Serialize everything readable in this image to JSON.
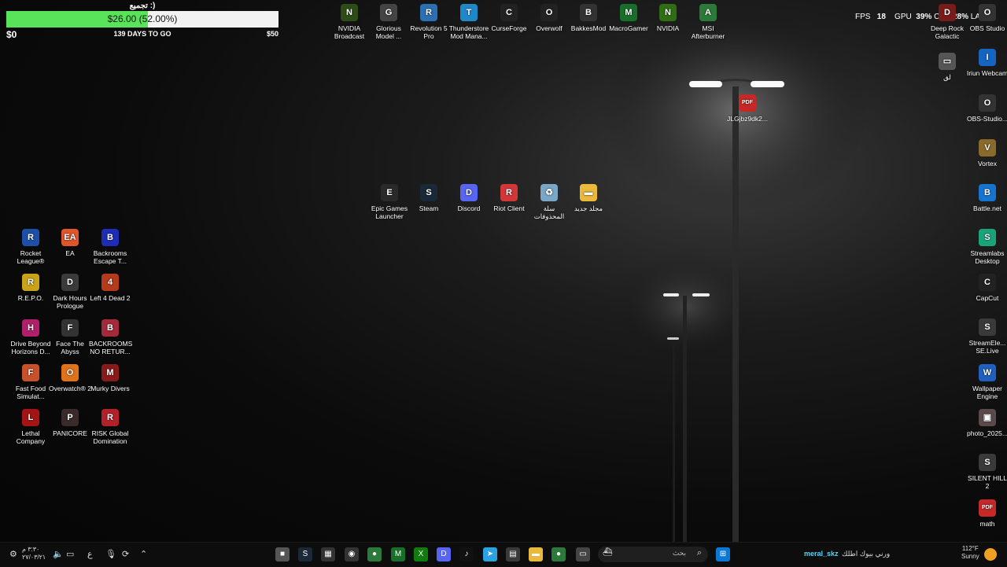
{
  "donation": {
    "title": "تجميع :)",
    "amount_label": "$26.00 (52.00%)",
    "progress_fraction": 0.52,
    "min": "$0",
    "days": "139 DAYS TO GO",
    "max": "$50"
  },
  "overlay": {
    "fps_label": "FPS",
    "fps": "18",
    "gpu_label": "GPU",
    "gpu": "39%",
    "cpu_label": "CPU",
    "cpu": "28%",
    "lat_label": "LAT"
  },
  "top_icons": [
    {
      "label": "NVIDIA Broadcast",
      "icon": "nvidia-broadcast-icon",
      "color": "#2c4d16",
      "glyph": "N"
    },
    {
      "label": "Glorious Model ...",
      "icon": "glorious-icon",
      "color": "#444",
      "glyph": "G"
    },
    {
      "label": "Revolution 5 Pro",
      "icon": "revolution-icon",
      "color": "#2d6fb3",
      "glyph": "R"
    },
    {
      "label": "Thunderstore Mod Mana...",
      "icon": "thunderstore-icon",
      "color": "#1e88c8",
      "glyph": "T"
    },
    {
      "label": "CurseForge",
      "icon": "curseforge-icon",
      "color": "#222",
      "glyph": "C"
    },
    {
      "label": "Overwolf",
      "icon": "overwolf-icon",
      "color": "#222",
      "glyph": "O"
    },
    {
      "label": "BakkesMod",
      "icon": "bakkesmod-icon",
      "color": "#333",
      "glyph": "B"
    },
    {
      "label": "MacroGamer",
      "icon": "macrogamer-icon",
      "color": "#1a6e2b",
      "glyph": "M"
    },
    {
      "label": "NVIDIA",
      "icon": "nvidia-icon",
      "color": "#2f6e12",
      "glyph": "N"
    },
    {
      "label": "MSI Afterburner",
      "icon": "msi-afterburner-icon",
      "color": "#2c7a3a",
      "glyph": "A"
    }
  ],
  "right_icons": [
    {
      "label": "Deep Rock Galactic",
      "icon": "deep-rock-icon",
      "color": "#7a1b1b",
      "glyph": "D"
    },
    {
      "label": "OBS Studio",
      "icon": "obs-studio-icon",
      "color": "#333",
      "glyph": "O"
    },
    {
      "label": "لق",
      "icon": "screenshot-icon",
      "color": "#555",
      "glyph": "▭"
    },
    {
      "label": "Iriun Webcam",
      "icon": "iriun-webcam-icon",
      "color": "#1565c0",
      "glyph": "I"
    },
    {
      "label": "OBS-Studio...",
      "icon": "obs-installer-icon",
      "color": "#333",
      "glyph": "O"
    },
    {
      "label": "Vortex",
      "icon": "vortex-icon",
      "color": "#8a6a2a",
      "glyph": "V"
    },
    {
      "label": "Battle.net",
      "icon": "battlenet-icon",
      "color": "#1673d0",
      "glyph": "B"
    },
    {
      "label": "Streamlabs Desktop",
      "icon": "streamlabs-icon",
      "color": "#1aa37a",
      "glyph": "S"
    },
    {
      "label": "CapCut",
      "icon": "capcut-icon",
      "color": "#222",
      "glyph": "C"
    },
    {
      "label": "StreamEle... SE.Live",
      "icon": "streamelements-icon",
      "color": "#3a3a3a",
      "glyph": "S"
    },
    {
      "label": "Wallpaper Engine",
      "icon": "wallpaper-engine-icon",
      "color": "#1f5fbf",
      "glyph": "W"
    },
    {
      "label": "photo_2025...",
      "icon": "photo-icon",
      "color": "#5a4a4a",
      "glyph": "▣"
    },
    {
      "label": "SILENT HILL 2",
      "icon": "silent-hill-icon",
      "color": "#3a3a3a",
      "glyph": "S"
    },
    {
      "label": "math",
      "icon": "pdf-icon",
      "color": "#c62828",
      "glyph": "PDF"
    }
  ],
  "pdf_file": {
    "label": "JLGjbz9dk2...",
    "icon": "pdf-icon",
    "color": "#c62828",
    "glyph": "PDF"
  },
  "middle_icons": [
    {
      "label": "Epic Games Launcher",
      "icon": "epic-games-icon",
      "color": "#2a2a2a",
      "glyph": "E"
    },
    {
      "label": "Steam",
      "icon": "steam-icon",
      "color": "#1b2838",
      "glyph": "S"
    },
    {
      "label": "Discord",
      "icon": "discord-icon",
      "color": "#5865f2",
      "glyph": "D"
    },
    {
      "label": "Riot Client",
      "icon": "riot-client-icon",
      "color": "#d13639",
      "glyph": "R"
    },
    {
      "label": "سلة المحذوفات",
      "icon": "recycle-bin-icon",
      "color": "#7aa7c7",
      "glyph": "♻"
    },
    {
      "label": "مجلد جديد",
      "icon": "folder-icon",
      "color": "#e8b93b",
      "glyph": "▬"
    }
  ],
  "left_icons": [
    {
      "label": "Rocket League®",
      "icon": "rocket-league-icon",
      "color": "#1d4fa8",
      "glyph": "R"
    },
    {
      "label": "EA",
      "icon": "ea-icon",
      "color": "#e0552a",
      "glyph": "EA"
    },
    {
      "label": "Backrooms Escape T...",
      "icon": "backrooms-escape-icon",
      "color": "#1d2db8",
      "glyph": "B"
    },
    {
      "label": "R.E.P.O.",
      "icon": "repo-icon",
      "color": "#c9a21a",
      "glyph": "R"
    },
    {
      "label": "Dark Hours Prologue",
      "icon": "dark-hours-icon",
      "color": "#3a3a3a",
      "glyph": "D"
    },
    {
      "label": "Left 4 Dead 2",
      "icon": "left4dead-icon",
      "color": "#b33a1a",
      "glyph": "4"
    },
    {
      "label": "Drive Beyond Horizons D...",
      "icon": "drive-beyond-icon",
      "color": "#b01f6a",
      "glyph": "H"
    },
    {
      "label": "Face The Abyss",
      "icon": "face-abyss-icon",
      "color": "#333",
      "glyph": "F"
    },
    {
      "label": "BACKROOMS NO RETUR...",
      "icon": "backrooms-no-return-icon",
      "color": "#a32a3a",
      "glyph": "B"
    },
    {
      "label": "Fast Food Simulat...",
      "icon": "fast-food-icon",
      "color": "#c8502a",
      "glyph": "F"
    },
    {
      "label": "Overwatch® 2",
      "icon": "overwatch-icon",
      "color": "#e0721a",
      "glyph": "O"
    },
    {
      "label": "Murky Divers",
      "icon": "murky-divers-icon",
      "color": "#8a1a1a",
      "glyph": "M"
    },
    {
      "label": "Lethal Company",
      "icon": "lethal-company-icon",
      "color": "#a31515",
      "glyph": "L"
    },
    {
      "label": "PANICORE",
      "icon": "panicore-icon",
      "color": "#3a2a2a",
      "glyph": "P"
    },
    {
      "label": "RISK Global Domination",
      "icon": "risk-icon",
      "color": "#b3202a",
      "glyph": "R"
    }
  ],
  "taskbar": {
    "clock_time": "٣:٣٠ م",
    "clock_date": "٢٧/٠٣/٢١",
    "lang": "ع",
    "search_text": "بحث",
    "user": "meral_skz",
    "message": "ورني بيوك اطلك",
    "weather_temp": "112°F",
    "weather_desc": "Sunny",
    "apps": [
      {
        "icon": "app-square-icon",
        "color": "#555",
        "glyph": "■"
      },
      {
        "icon": "steam-taskbar-icon",
        "color": "#1b2838",
        "glyph": "S"
      },
      {
        "icon": "app-icon",
        "color": "#333",
        "glyph": "▦"
      },
      {
        "icon": "obs-taskbar-icon",
        "color": "#333",
        "glyph": "◉"
      },
      {
        "icon": "chrome-icon",
        "color": "#2b7a3b",
        "glyph": "●"
      },
      {
        "icon": "macrogamer-taskbar-icon",
        "color": "#1a6e2b",
        "glyph": "M"
      },
      {
        "icon": "xbox-icon",
        "color": "#107c10",
        "glyph": "X"
      },
      {
        "icon": "discord-taskbar-icon",
        "color": "#5865f2",
        "glyph": "D"
      },
      {
        "icon": "tiktok-icon",
        "color": "#111",
        "glyph": "♪"
      },
      {
        "icon": "telegram-icon",
        "color": "#2aa3e0",
        "glyph": "➤"
      },
      {
        "icon": "store-icon",
        "color": "#3a3a3a",
        "glyph": "▤"
      },
      {
        "icon": "file-explorer-icon",
        "color": "#e8b93b",
        "glyph": "▬"
      },
      {
        "icon": "chrome-icon",
        "color": "#2b7a3b",
        "glyph": "●"
      },
      {
        "icon": "app-window-icon",
        "color": "#444",
        "glyph": "▭"
      }
    ]
  }
}
